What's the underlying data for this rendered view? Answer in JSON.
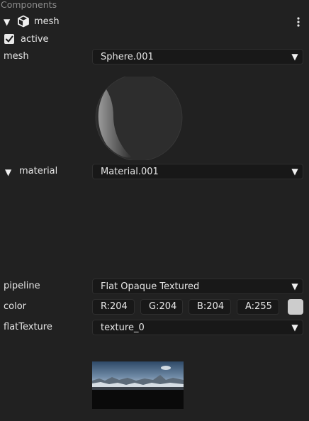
{
  "panel": {
    "title": "Components"
  },
  "mesh_component": {
    "title": "mesh",
    "active_label": "active",
    "active_checked": true,
    "mesh_label": "mesh",
    "mesh_value": "Sphere.001"
  },
  "material": {
    "label": "material",
    "value": "Material.001",
    "pipeline_label": "pipeline",
    "pipeline_value": "Flat Opaque Textured",
    "color_label": "color",
    "color": {
      "r": "R:204",
      "g": "G:204",
      "b": "B:204",
      "a": "A:255",
      "swatch": "#cccccc"
    },
    "flat_texture_label": "flatTexture",
    "flat_texture_value": "texture_0"
  },
  "icons": {
    "collapse": "triangle-down-icon",
    "component": "cube-icon",
    "menu": "kebab-menu-icon",
    "dropdown": "dropdown-arrow-icon",
    "check": "checkmark-icon"
  }
}
